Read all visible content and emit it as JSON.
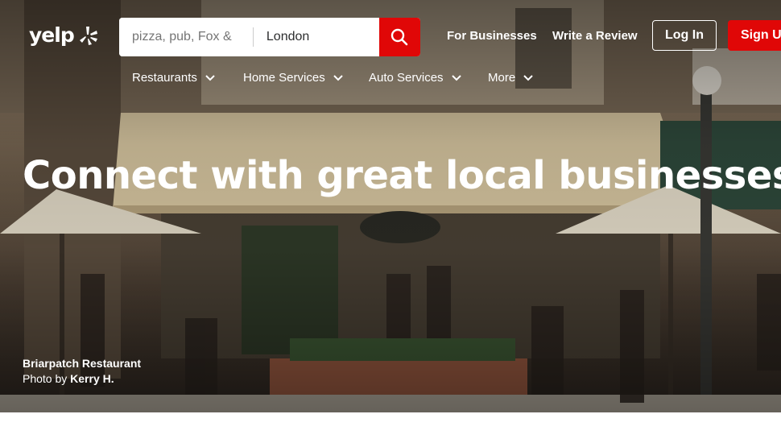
{
  "brand": {
    "logo_text": "yelp"
  },
  "search": {
    "find_placeholder": "pizza, pub, Fox &",
    "near_value": "London"
  },
  "header": {
    "for_businesses": "For Businesses",
    "write_review": "Write a Review",
    "log_in": "Log In",
    "sign_up": "Sign Up"
  },
  "categories": [
    {
      "label": "Restaurants"
    },
    {
      "label": "Home Services"
    },
    {
      "label": "Auto Services"
    },
    {
      "label": "More"
    }
  ],
  "hero": {
    "headline": "Connect with great local businesses",
    "business_name": "Briarpatch Restaurant",
    "photo_by_prefix": "Photo by",
    "photographer": "Kerry H."
  },
  "colors": {
    "brand_red": "#e00707",
    "text_white": "#ffffff"
  }
}
